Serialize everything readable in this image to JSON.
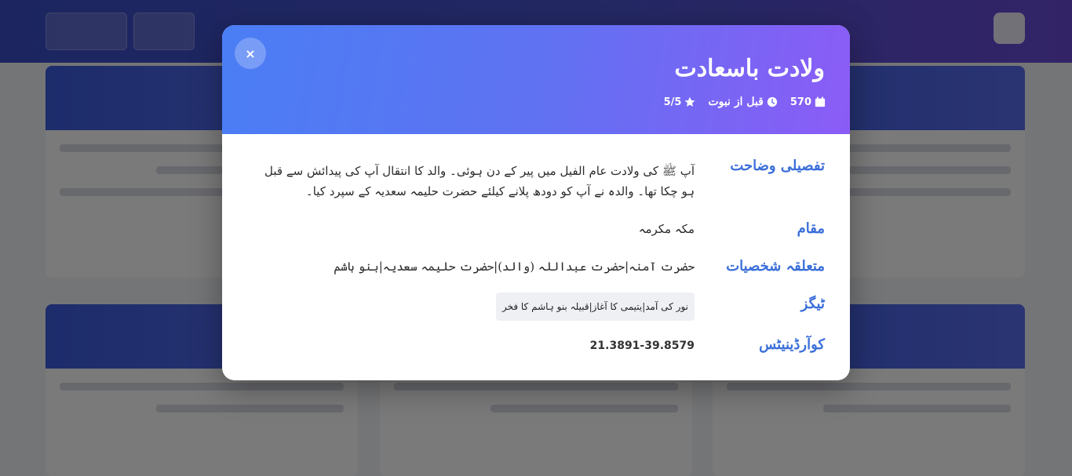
{
  "modal": {
    "close_label": "×",
    "title": "ولادت باسعادت",
    "meta": {
      "year": "570",
      "year_icon": "calendar-icon",
      "period": "قبل از نبوت",
      "period_icon": "clock-icon",
      "rating": "5/5",
      "rating_icon": "star-icon"
    },
    "fields": {
      "description_label": "تفصیلی وضاحت",
      "description": "آپ ﷺ کی ولادت عام الفیل میں پیر کے دن ہوئی۔ والد کا انتقال آپ کی پیدائش سے قبل ہو چکا تھا۔ والدہ نے آپ کو دودھ پلانے کیلئے حضرت حلیمہ سعدیہ کے سپرد کیا۔",
      "place_label": "مقام",
      "place": "مکہ مکرمہ",
      "people_label": "متعلقہ شخصیات",
      "people": "حضرت آمنہ|حضرت عبداللہ (والد)|حضرت حلیمہ سعدیہ|بنو ہاشم",
      "tags_label": "ٹیگز",
      "tags": "نور کی آمد|یتیمی کا آغاز|قبیلہ بنو ہاشم کا فخر",
      "coords_label": "کوآرڈینیٹس",
      "coords": "21.3891-39.8579"
    }
  },
  "colors": {
    "header_gradient_start": "#4a7ef4",
    "header_gradient_end": "#8b5cf6",
    "label_blue": "#3b6fd9",
    "overlay": "rgba(0,0,0,0.52)"
  }
}
